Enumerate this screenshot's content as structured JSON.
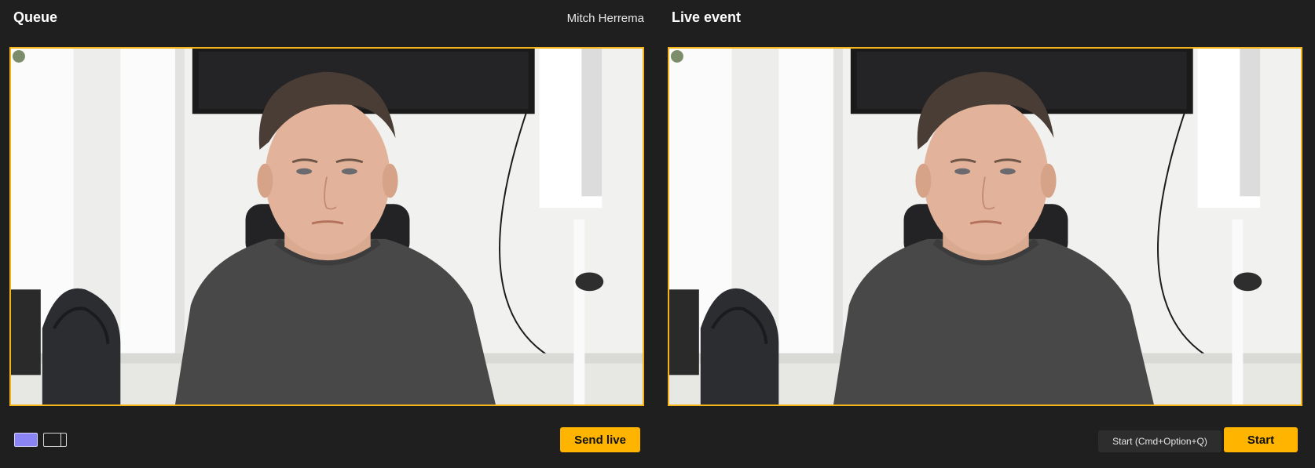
{
  "queue": {
    "title": "Queue",
    "presenter_name": "Mitch Herrema",
    "send_live_label": "Send live",
    "layout_options": [
      "single-layout-icon",
      "split-layout-icon"
    ],
    "selected_layout": "single"
  },
  "live": {
    "title": "Live event",
    "shortcut_hint": "Start (Cmd+Option+Q)",
    "start_label": "Start"
  },
  "colors": {
    "background": "#1f1f1f",
    "accent": "#ffb400",
    "preview_border": "#f5b417",
    "selected_layout": "#8b84f5"
  }
}
